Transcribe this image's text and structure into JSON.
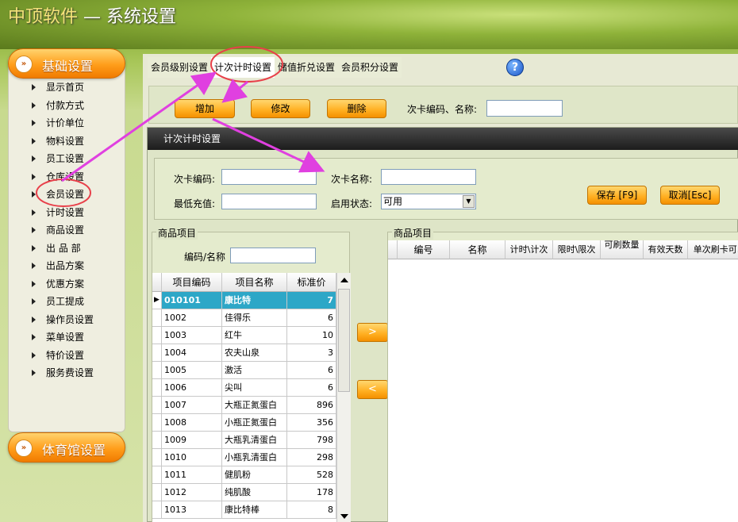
{
  "app": {
    "brand": "中顶软件",
    "separator": " — ",
    "title": "系统设置"
  },
  "sidebar": {
    "header_basic": "基础设置",
    "items": [
      {
        "label": "显示首页"
      },
      {
        "label": "付款方式"
      },
      {
        "label": "计价单位"
      },
      {
        "label": "物料设置"
      },
      {
        "label": "员工设置"
      },
      {
        "label": "仓库设置"
      },
      {
        "label": "会员设置"
      },
      {
        "label": "计时设置"
      },
      {
        "label": "商品设置"
      },
      {
        "label": "出 品 部"
      },
      {
        "label": "出品方案"
      },
      {
        "label": "优惠方案"
      },
      {
        "label": "员工提成"
      },
      {
        "label": "操作员设置"
      },
      {
        "label": "菜单设置"
      },
      {
        "label": "特价设置"
      },
      {
        "label": "服务费设置"
      }
    ],
    "header_gym": "体育馆设置"
  },
  "tabs": [
    {
      "label": "会员级别设置"
    },
    {
      "label": "计次计时设置"
    },
    {
      "label": "储值折兑设置"
    },
    {
      "label": "会员积分设置"
    }
  ],
  "help_icon": "?",
  "toolbar": {
    "add_label": "增加",
    "edit_label": "修改",
    "delete_label": "删除",
    "search_label": "次卡编码、名称:",
    "search_value": ""
  },
  "dialog": {
    "title": "计次计时设置",
    "card_code_label": "次卡编码:",
    "card_code_value": "",
    "card_name_label": "次卡名称:",
    "card_name_value": "",
    "min_charge_label": "最低充值:",
    "min_charge_value": "",
    "status_label": "启用状态:",
    "status_value": "可用",
    "save_label": "保存 [F9]",
    "cancel_label": "取消[Esc]"
  },
  "left_products": {
    "group_title": "商品项目",
    "filter_label": "编码/名称",
    "filter_value": "",
    "columns": [
      "项目编码",
      "项目名称",
      "标准价"
    ],
    "rows": [
      {
        "code": "010101",
        "name": "康比特",
        "price": "7"
      },
      {
        "code": "1002",
        "name": "佳得乐",
        "price": "6"
      },
      {
        "code": "1003",
        "name": "红牛",
        "price": "10"
      },
      {
        "code": "1004",
        "name": "农夫山泉",
        "price": "3"
      },
      {
        "code": "1005",
        "name": "激活",
        "price": "6"
      },
      {
        "code": "1006",
        "name": "尖叫",
        "price": "6"
      },
      {
        "code": "1007",
        "name": "大瓶正氮蛋白",
        "price": "896"
      },
      {
        "code": "1008",
        "name": "小瓶正氮蛋白",
        "price": "356"
      },
      {
        "code": "1009",
        "name": "大瓶乳清蛋白",
        "price": "798"
      },
      {
        "code": "1010",
        "name": "小瓶乳清蛋白",
        "price": "298"
      },
      {
        "code": "1011",
        "name": "健肌粉",
        "price": "528"
      },
      {
        "code": "1012",
        "name": "纯肌酸",
        "price": "178"
      },
      {
        "code": "1013",
        "name": "康比特棒",
        "price": "8"
      }
    ]
  },
  "move_right": ">",
  "move_left": "<",
  "right_products": {
    "group_title": "商品项目",
    "columns": [
      "编号",
      "名称",
      "计时\\计次",
      "限时\\限次",
      "可刷数量",
      "有效天数",
      "单次刷卡可..."
    ]
  },
  "colors": {
    "accent_orange": "#ff9d1a",
    "selection": "#2da7c7",
    "annotation": "#e040e0"
  }
}
